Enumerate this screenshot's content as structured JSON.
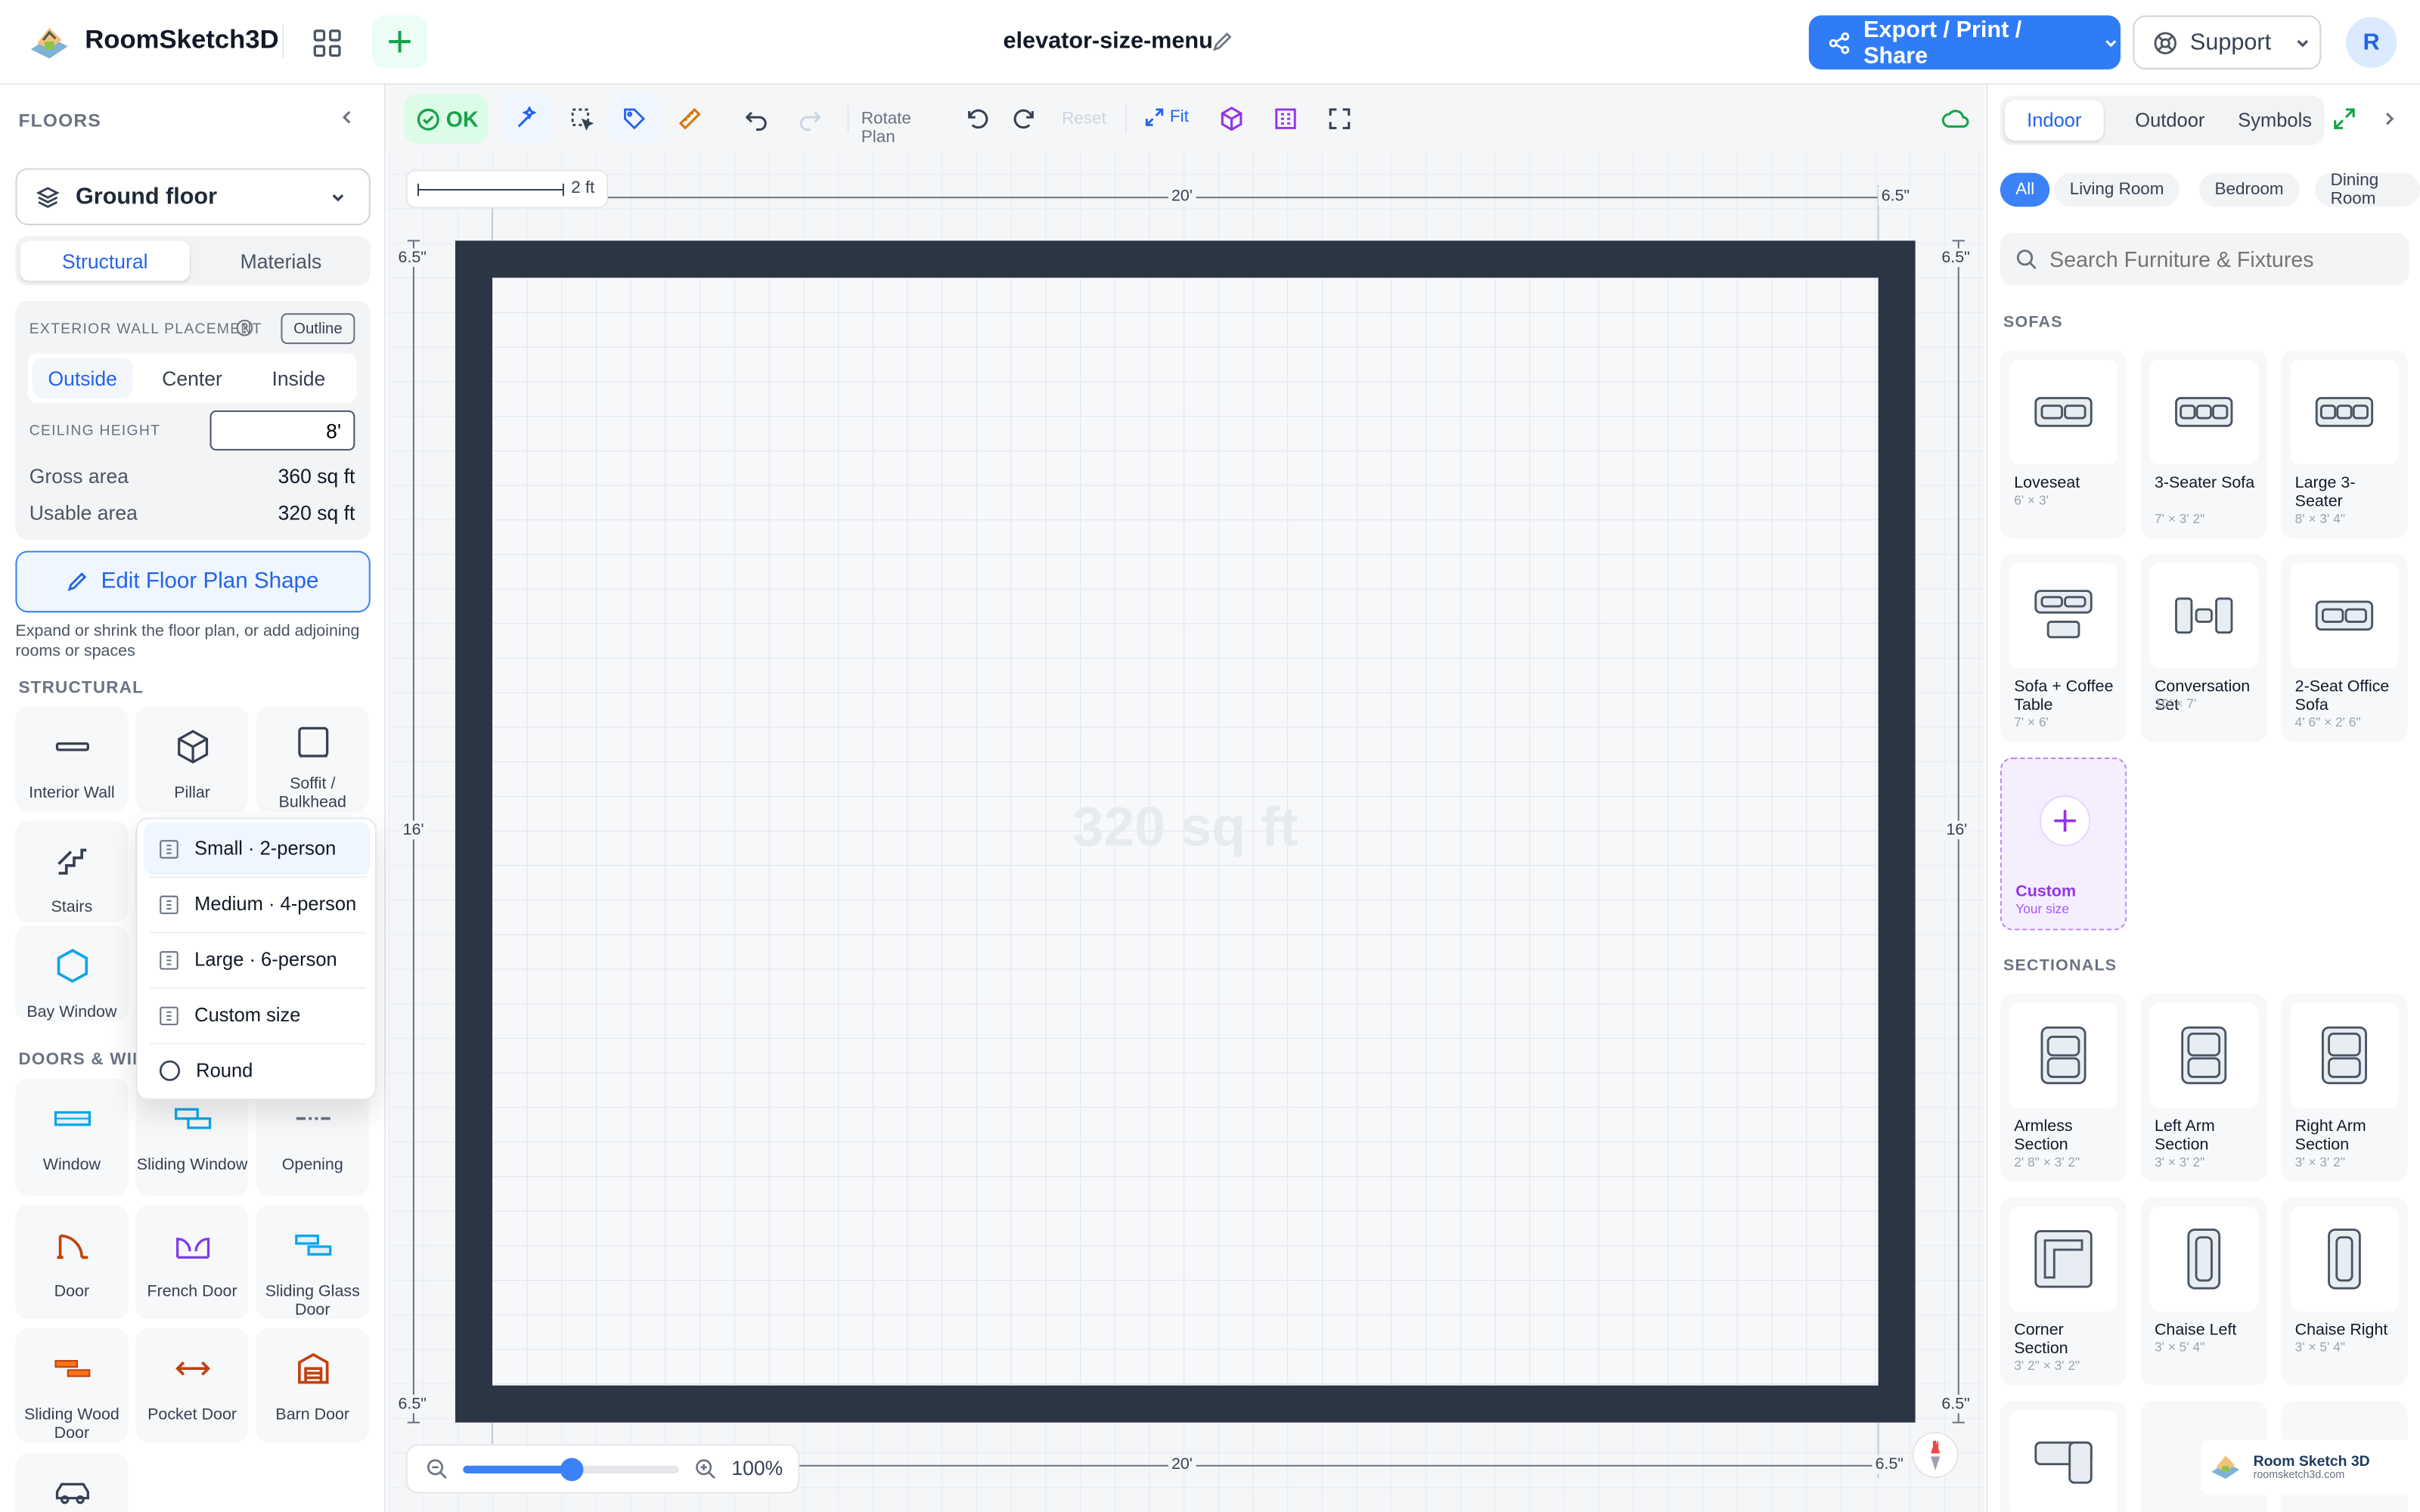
{
  "app": {
    "name": "RoomSketch3D",
    "doc_title": "elevator-size-menu",
    "avatar": "R"
  },
  "header": {
    "export_label": "Export / Print / Share",
    "support_label": "Support"
  },
  "left": {
    "section_title": "FLOORS",
    "floor_selected": "Ground floor",
    "tabs": [
      "Structural",
      "Materials"
    ],
    "wall_placement_label": "EXTERIOR WALL PLACEMENT",
    "outline_label": "Outline",
    "placement_options": [
      "Outside",
      "Center",
      "Inside"
    ],
    "ceiling_label": "CEILING HEIGHT",
    "ceiling_value": "8'",
    "gross_label": "Gross area",
    "gross_value": "360 sq ft",
    "usable_label": "Usable area",
    "usable_value": "320 sq ft",
    "edit_label": "Edit Floor Plan Shape",
    "edit_hint": "Expand or shrink the floor plan, or add adjoining rooms or spaces",
    "structural_heading": "STRUCTURAL",
    "structural": [
      "Interior Wall",
      "Pillar",
      "Soffit / Bulkhead",
      "Stairs",
      "Bay Window"
    ],
    "doors_heading": "DOORS & WIND",
    "doors": [
      "Window",
      "Sliding Window",
      "Opening",
      "Door",
      "French Door",
      "Sliding Glass Door",
      "Sliding Wood Door",
      "Pocket Door",
      "Barn Door"
    ]
  },
  "elevator_menu": [
    "Small · 2-person",
    "Medium · 4-person",
    "Large · 6-person",
    "Custom size",
    "Round"
  ],
  "toolbar": {
    "ok": "OK",
    "rotate": "Rotate Plan",
    "reset": "Reset",
    "fit": "Fit"
  },
  "plan": {
    "scale": "2 ft",
    "width_top": "20'",
    "width_bottom": "20'",
    "height_left": "16'",
    "height_right": "16'",
    "wall": "6.5\"",
    "area": "320 sq ft"
  },
  "zoom": {
    "percent": "100%",
    "level": 0.5
  },
  "right": {
    "tabs": [
      "Indoor",
      "Outdoor",
      "Symbols"
    ],
    "chips": [
      "All",
      "Living Room",
      "Bedroom",
      "Dining Room"
    ],
    "search_placeholder": "Search Furniture & Fixtures",
    "sofas_heading": "SOFAS",
    "sofas": [
      {
        "name": "Loveseat",
        "size": "6' × 3'"
      },
      {
        "name": "3-Seater Sofa",
        "size": "7' × 3' 2\""
      },
      {
        "name": "Large 3-Seater",
        "size": "8' × 3' 4\""
      },
      {
        "name": "Sofa + Coffee Table",
        "size": "7' × 6'"
      },
      {
        "name": "Conversation Set",
        "size": "10' × 7'"
      },
      {
        "name": "2-Seat Office Sofa",
        "size": "4' 6\" × 2' 6\""
      }
    ],
    "custom": {
      "name": "Custom",
      "size": "Your size"
    },
    "sectionals_heading": "SECTIONALS",
    "sectionals": [
      {
        "name": "Armless Section",
        "size": "2' 8\" × 3' 2\""
      },
      {
        "name": "Left Arm Section",
        "size": "3' × 3' 2\""
      },
      {
        "name": "Right Arm Section",
        "size": "3' × 3' 2\""
      },
      {
        "name": "Corner Section",
        "size": "3' 2\" × 3' 2\""
      },
      {
        "name": "Chaise Left",
        "size": "3' × 5' 4\""
      },
      {
        "name": "Chaise Right",
        "size": "3' × 5' 4\""
      }
    ],
    "watermark": {
      "name": "Room Sketch 3D",
      "url": "roomsketch3d.com"
    }
  },
  "compass": "N",
  "colors": {
    "accent": "#2f7cf6",
    "wall": "#2b3544",
    "ok_green": "#16a34a",
    "custom_purple": "#9333ea"
  }
}
